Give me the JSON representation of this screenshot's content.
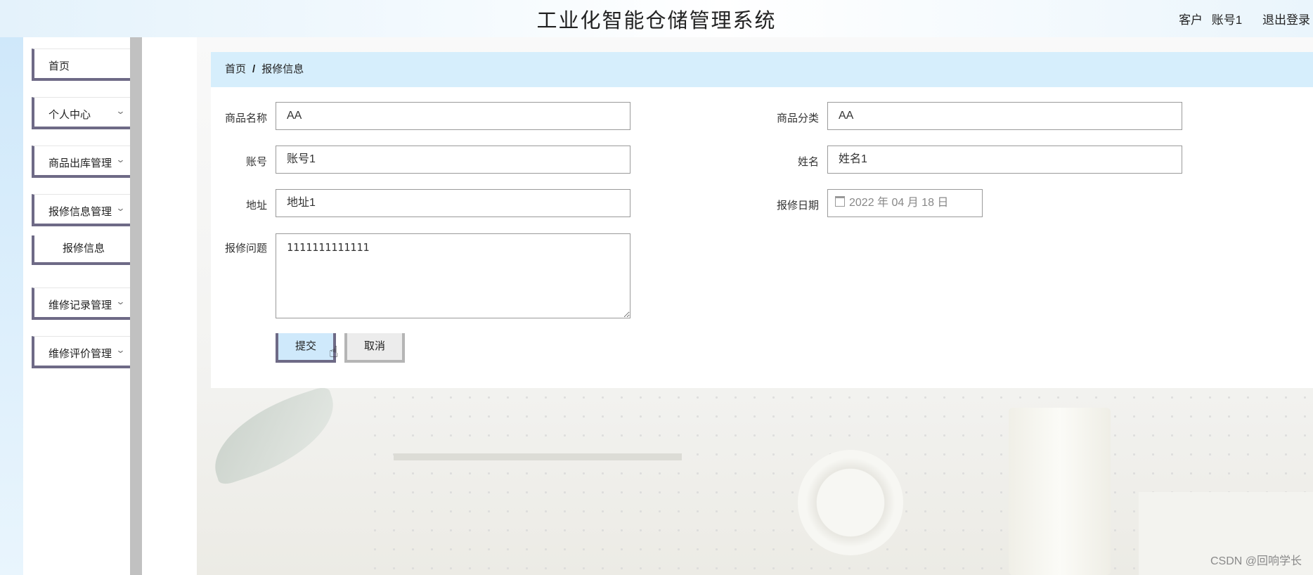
{
  "header": {
    "title": "工业化智能仓储管理系统",
    "role": "客户",
    "username": "账号1",
    "logout_label": "退出登录"
  },
  "sidebar": {
    "items": [
      {
        "label": "首页",
        "has_chevron": false
      },
      {
        "label": "个人中心",
        "has_chevron": true
      },
      {
        "label": "商品出库管理",
        "has_chevron": true
      },
      {
        "label": "报修信息管理",
        "has_chevron": true
      },
      {
        "label": "报修信息",
        "is_sub": true
      },
      {
        "label": "维修记录管理",
        "has_chevron": true
      },
      {
        "label": "维修评价管理",
        "has_chevron": true
      }
    ],
    "chevron_icon": "chevron-down-icon"
  },
  "breadcrumb": {
    "home": "首页",
    "separator": "/",
    "current": "报修信息"
  },
  "form": {
    "product_name": {
      "label": "商品名称",
      "value": "AA"
    },
    "product_category": {
      "label": "商品分类",
      "value": "AA"
    },
    "account": {
      "label": "账号",
      "value": "账号1"
    },
    "name": {
      "label": "姓名",
      "value": "姓名1"
    },
    "address": {
      "label": "地址",
      "value": "地址1"
    },
    "repair_date": {
      "label": "报修日期",
      "value": "2022 年 04 月 18 日",
      "icon": "calendar-icon"
    },
    "repair_issue": {
      "label": "报修问题",
      "value": "1111111111111"
    },
    "submit_label": "提交",
    "cancel_label": "取消"
  },
  "watermark": "CSDN @回响学长",
  "colors": {
    "accent_border": "#6e6a86",
    "breadcrumb_bg": "#d6eefc",
    "submit_bg": "#cfe9fb"
  }
}
